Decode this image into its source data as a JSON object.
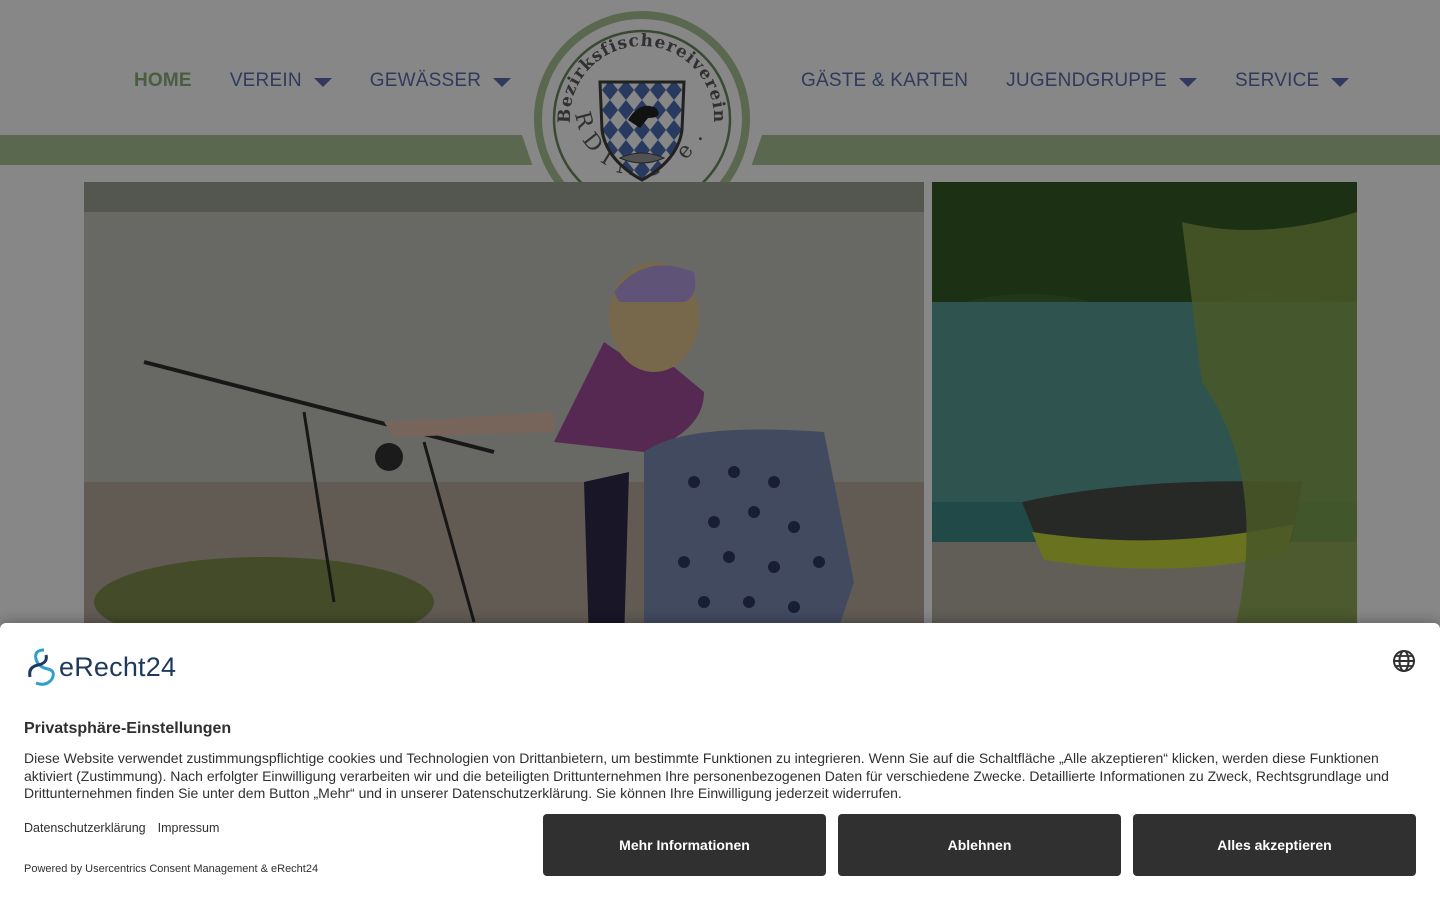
{
  "nav": {
    "left": [
      {
        "label": "HOME",
        "active": true,
        "dropdown": false
      },
      {
        "label": "VEREIN",
        "active": false,
        "dropdown": true
      },
      {
        "label": "GEWÄSSER",
        "active": false,
        "dropdown": true
      }
    ],
    "right": [
      {
        "label": "GÄSTE & KARTEN",
        "active": false,
        "dropdown": false
      },
      {
        "label": "JUGENDGRUPPE",
        "active": false,
        "dropdown": true
      },
      {
        "label": "SERVICE",
        "active": false,
        "dropdown": true
      }
    ]
  },
  "logo": {
    "arc_text": "Bezirksfischereiverein",
    "bottom_text": "ERDING e.V."
  },
  "colors": {
    "nav_link": "#5d6fb0",
    "nav_active": "#8bb079",
    "green_bar": "#a9c596",
    "button_bg": "#303030",
    "brand_text": "#1d3a5c"
  },
  "hero": {
    "left_image": "child-fishing-at-lake-photo",
    "right_image": "rowing-boat-on-lake-shore-photo"
  },
  "consent": {
    "brand_name": "eRecht24",
    "language_icon": "globe-icon",
    "title": "Privatsphäre-Einstellungen",
    "text": "Diese Website verwendet zustimmungspflichtige cookies und Technologien von Drittanbietern, um bestimmte Funktionen zu integrieren. Wenn Sie auf die Schaltfläche „Alle akzeptieren“ klicken, werden diese Funktionen aktiviert (Zustimmung). Nach erfolgter Einwilligung verarbeiten wir und die beteiligten Drittunternehmen Ihre personenbezogenen Daten für verschiedene Zwecke. Detaillierte Informationen zu Zweck, Rechtsgrundlage und Drittunternehmen finden Sie unter dem Button „Mehr“ und in unserer Datenschutzerklärung. Sie können Ihre Einwilligung jederzeit widerrufen.",
    "link_privacy": "Datenschutzerklärung",
    "link_imprint": "Impressum",
    "powered_by": "Powered by Usercentrics Consent Management & eRecht24",
    "btn_more": "Mehr Informationen",
    "btn_deny": "Ablehnen",
    "btn_accept": "Alles akzeptieren"
  }
}
